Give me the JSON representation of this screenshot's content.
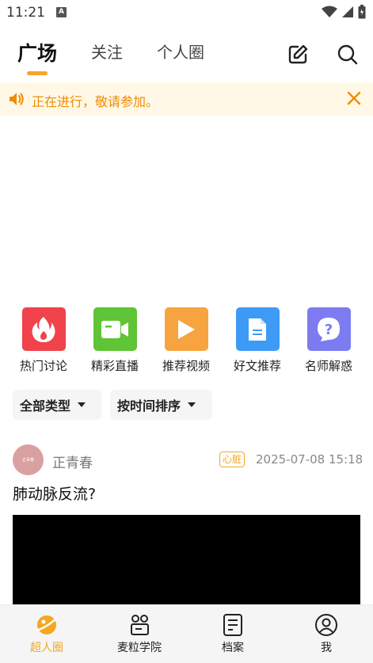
{
  "status_bar": {
    "time": "11:21",
    "notification_glyph": "A"
  },
  "top_nav": {
    "tabs": [
      {
        "label": "广场",
        "active": true
      },
      {
        "label": "关注",
        "active": false
      },
      {
        "label": "个人圈",
        "active": false
      }
    ],
    "accent_color": "#f5a623"
  },
  "notice": {
    "text": "正在进行，敬请参加。",
    "color": "#f08a00"
  },
  "features": [
    {
      "label": "热门讨论",
      "icon": "flame-icon",
      "color": "#f0434b"
    },
    {
      "label": "精彩直播",
      "icon": "video-camera-icon",
      "color": "#5fc436"
    },
    {
      "label": "推荐视频",
      "icon": "play-icon",
      "color": "#f7a440"
    },
    {
      "label": "好文推荐",
      "icon": "document-icon",
      "color": "#3d9bf5"
    },
    {
      "label": "名师解惑",
      "icon": "question-icon",
      "color": "#7c7cf0"
    }
  ],
  "filters": {
    "type": "全部类型",
    "sort": "按时间排序"
  },
  "post": {
    "author": "正青春",
    "avatar_text": "正青春",
    "tag": "心脏",
    "time": "2025-07-08 15:18",
    "title": "肺动脉反流?"
  },
  "bottom_nav": [
    {
      "label": "超人圈",
      "icon": "planet-icon",
      "active": true
    },
    {
      "label": "麦粒学院",
      "icon": "people-board-icon",
      "active": false
    },
    {
      "label": "档案",
      "icon": "file-list-icon",
      "active": false
    },
    {
      "label": "我",
      "icon": "user-icon",
      "active": false
    }
  ]
}
